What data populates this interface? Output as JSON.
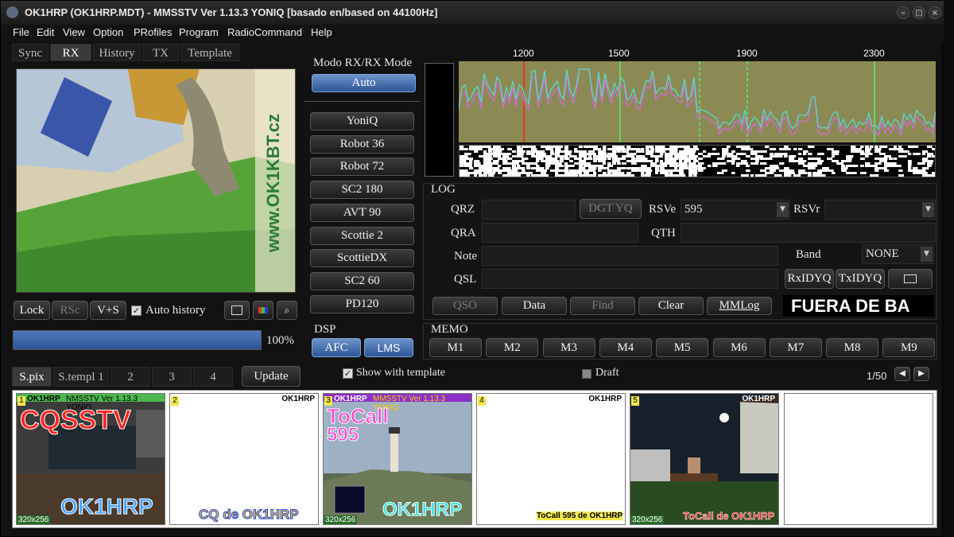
{
  "window": {
    "title": "OK1HRP (OK1HRP.MDT) - MMSSTV Ver 1.13.3 YONIQ [basado en/based on 44100Hz]"
  },
  "menu": [
    "File",
    "Edit",
    "View",
    "Option",
    "PRofiles",
    "Program",
    "RadioCommand",
    "Help"
  ],
  "tabs": [
    "Sync",
    "RX",
    "History",
    "TX",
    "Template"
  ],
  "rx_image": {
    "watermark": "www.OK1KBT.cz"
  },
  "controls": {
    "lock": "Lock",
    "rsc": "RSc",
    "vs": "V+S",
    "auto_history": "Auto history",
    "progress_pct": "100%",
    "progress": 1.0
  },
  "mode": {
    "header": "Modo RX/RX Mode",
    "auto": "Auto",
    "modes": [
      "YoniQ",
      "Robot 36",
      "Robot 72",
      "SC2 180",
      "AVT 90",
      "Scottie 2",
      "ScottieDX",
      "SC2 60",
      "PD120"
    ]
  },
  "dsp": {
    "header": "DSP",
    "afc": "AFC",
    "lms": "LMS"
  },
  "spectrum": {
    "ticks": [
      "1200",
      "1500",
      "1900",
      "2300"
    ]
  },
  "log": {
    "header": "LOG",
    "qrz": "QRZ",
    "dgt": "DGT YQ",
    "rsve": "RSVe",
    "rsve_value": "595",
    "rsvr": "RSVr",
    "qra": "QRA",
    "qth": "QTH",
    "note": "Note",
    "band": "Band",
    "band_value": "NONE",
    "qsl": "QSL",
    "rxidyq": "RxIDYQ",
    "txidyq": "TxIDYQ",
    "qso": "QSO",
    "data": "Data",
    "find": "Find",
    "clear": "Clear",
    "mmlog": "MMLog",
    "status": "FUERA DE BA"
  },
  "memo": {
    "header": "MEMO",
    "items": [
      "M1",
      "M2",
      "M3",
      "M4",
      "M5",
      "M6",
      "M7",
      "M8",
      "M9"
    ]
  },
  "bottom_tabs": [
    "S.pix",
    "S.templ 1",
    "2",
    "3",
    "4"
  ],
  "update": "Update",
  "show_template": "Show with template",
  "draft": "Draft",
  "page": "1/50",
  "thumbs": [
    {
      "num": "1",
      "header": "NMSSTV Ver 1.13.3 YONIQ",
      "call_left": "OK1HRP",
      "big": "CQSSTV",
      "bottom": "OK1HRP",
      "res": "320x256"
    },
    {
      "num": "2",
      "callsign": "OK1HRP",
      "bottom": "CQ de OK1HRP"
    },
    {
      "num": "3",
      "header": "MMSSTV Ver 1.13.3 YONIQ",
      "call_left": "OK1HRP",
      "big": "ToCall",
      "big2": "595",
      "bottom": "OK1HRP",
      "res": "320x256"
    },
    {
      "num": "4",
      "callsign": "OK1HRP",
      "bottom": "ToCall 595 de OK1HRP"
    },
    {
      "num": "5",
      "callsign": "OK1HRP",
      "bottom": "ToCall de OK1HRP",
      "res": "320x256"
    }
  ],
  "colors": {
    "accent": "#3f6fb4",
    "spectrum_bg": "#8b8a55",
    "spectrum_line": "#5ed6c7",
    "spectrum_line2": "#d46cd4",
    "marker_green": "#64d664",
    "marker_red": "#e03a1e"
  }
}
